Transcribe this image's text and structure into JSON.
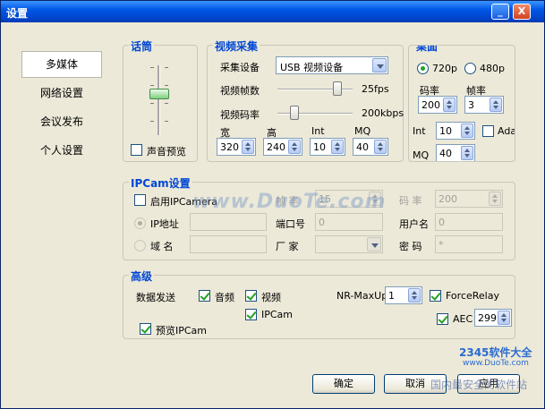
{
  "window": {
    "title": "设置",
    "min_label": "_",
    "max_label": "□",
    "close_label": "X"
  },
  "nav": [
    {
      "label": "多媒体"
    },
    {
      "label": "网络设置"
    },
    {
      "label": "会议发布"
    },
    {
      "label": "个人设置"
    }
  ],
  "mic": {
    "title": "话筒",
    "preview_label": "声音预览",
    "preview_checked": false
  },
  "video": {
    "title": "视频采集",
    "device_label": "采集设备",
    "device_value": "USB 视频设备",
    "fps_label": "视频帧数",
    "fps_value": "25fps",
    "fps_level": 0.85,
    "bitrate_label": "视频码率",
    "bitrate_value": "200kbps",
    "bitrate_level": 0.15,
    "width_label": "宽",
    "width_value": "320",
    "height_label": "高",
    "height_value": "240",
    "int_label": "Int",
    "int_value": "10",
    "mq_label": "MQ",
    "mq_value": "40"
  },
  "desktop": {
    "title": "桌面",
    "res_720": "720p",
    "res_480": "480p",
    "selected": "720p",
    "bitrate_label": "码率",
    "bitrate_value": "200",
    "fps_label": "帧率",
    "fps_value": "3",
    "int_label": "Int",
    "int_value": "10",
    "adap_label": "Adap",
    "mq_label": "MQ",
    "mq_value": "40"
  },
  "ipcam": {
    "title": "IPCam设置",
    "enable_label": "启用IPCamera",
    "fps_label": "帧 率",
    "fps_value": "15",
    "bitrate_label": "码 率",
    "bitrate_value": "200",
    "ip_label": "IP地址",
    "ip_value": "",
    "port_label": "端口号",
    "port_value": "0",
    "user_label": "用户名",
    "user_value": "0",
    "domain_label": "域 名",
    "domain_value": "",
    "vendor_label": "厂 家",
    "vendor_value": "",
    "password_label": "密 码",
    "password_value": "*"
  },
  "advanced": {
    "title": "高级",
    "send_label": "数据发送",
    "audio_label": "音频",
    "video_label": "视频",
    "ipcam_label": "IPCam",
    "nr_label": "NR-MaxUp",
    "nr_value": "1",
    "force_relay_label": "ForceRelay",
    "aec_label": "AEC",
    "aec_value": "299",
    "preview_ipcam_label": "预览IPCam"
  },
  "buttons": {
    "ok": "确定",
    "cancel": "取消",
    "apply": "应用"
  },
  "watermarks": {
    "site": "www.DuoTe.com",
    "brand": "2345软件大全",
    "brand_url": "www.DuoTe.com",
    "footer": "国内最安全的软件站"
  }
}
